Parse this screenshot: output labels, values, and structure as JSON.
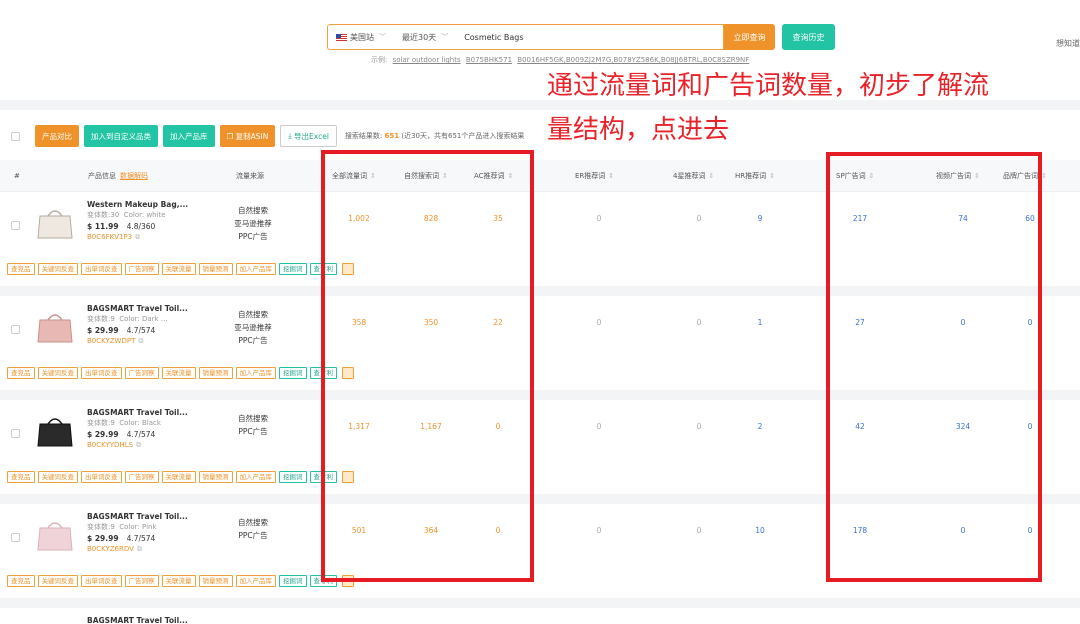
{
  "search": {
    "site": "美国站",
    "period": "最近30天",
    "keyword": "Cosmetic Bags",
    "query_button": "立即查询",
    "history_button": "查询历史",
    "corner_link": "想知道",
    "examples_label": "示例:",
    "examples": [
      "solar outdoor lights",
      "B075BHK571",
      "B0016HF5GK,B009ZJ2M7G,B078YZ586K,B08JJ68TRL,B0C8SZR9NF"
    ]
  },
  "annotation": {
    "line1": "通过流量词和广告词数量，初步了解流",
    "line2": "量结构，点进去",
    "color": "#e8232a"
  },
  "toolbar": {
    "compare": "产品对比",
    "add_custom": "加入到自定义品类",
    "add_library": "加入产品库",
    "copy_asin": "复制ASIN",
    "export": "导出Excel",
    "stat_prefix": "搜索结果数:",
    "stat_count": "651",
    "stat_suffix": "(近30天，共有651个产品进入搜索结果"
  },
  "columns": {
    "index": "#",
    "product": "产品信息",
    "product_link": "数据解码",
    "traffic": "流量来源",
    "all_kw": "全部流量词",
    "organic": "自然搜索词",
    "ac": "AC推荐词",
    "er": "ER推荐词",
    "four_star": "4星推荐词",
    "hr": "HR推荐词",
    "sp": "SP广告词",
    "video": "视频广告词",
    "brand": "品牌广告词"
  },
  "tags": [
    "查竞品",
    "关键词反查",
    "出单词反查",
    "广告洞察",
    "关联流量",
    "销量预测",
    "加入产品库"
  ],
  "tags_green": [
    "挖掘词",
    "查专利"
  ],
  "rows": [
    {
      "name": "Western Makeup Bag,...",
      "variants": "变体数:30",
      "color": "Color: white",
      "price": "$ 11.99",
      "rating": "4.8/360",
      "asin": "B0C6FKV1P3",
      "traffic": [
        "自然搜索",
        "亚马逊推荐",
        "PPC广告"
      ],
      "all_kw": "1,002",
      "organic": "828",
      "ac": "35",
      "er": "0",
      "four_star": "0",
      "hr": "9",
      "sp": "217",
      "video": "74",
      "brand": "60"
    },
    {
      "name": "BAGSMART Travel Toil...",
      "variants": "变体数:9",
      "color": "Color: Dark ...",
      "price": "$ 29.99",
      "rating": "4.7/574",
      "asin": "B0CKYZWDPT",
      "traffic": [
        "自然搜索",
        "亚马逊推荐",
        "PPC广告"
      ],
      "all_kw": "358",
      "organic": "350",
      "ac": "22",
      "er": "0",
      "four_star": "0",
      "hr": "1",
      "sp": "27",
      "video": "0",
      "brand": "0"
    },
    {
      "name": "BAGSMART Travel Toil...",
      "variants": "变体数:9",
      "color": "Color: Black",
      "price": "$ 29.99",
      "rating": "4.7/574",
      "asin": "B0CKYYDHLS",
      "traffic": [
        "自然搜索",
        "PPC广告"
      ],
      "all_kw": "1,317",
      "organic": "1,167",
      "ac": "0",
      "er": "0",
      "four_star": "0",
      "hr": "2",
      "sp": "42",
      "video": "324",
      "brand": "0"
    },
    {
      "name": "BAGSMART Travel Toil...",
      "variants": "变体数:9",
      "color": "Color: Pink",
      "price": "$ 29.99",
      "rating": "4.7/574",
      "asin": "B0CKYZ6RDV",
      "traffic": [
        "自然搜索",
        "PPC广告"
      ],
      "all_kw": "501",
      "organic": "364",
      "ac": "0",
      "er": "0",
      "four_star": "0",
      "hr": "10",
      "sp": "178",
      "video": "0",
      "brand": "0"
    }
  ],
  "partial_row_name": "BAGSMART Travel Toil..."
}
